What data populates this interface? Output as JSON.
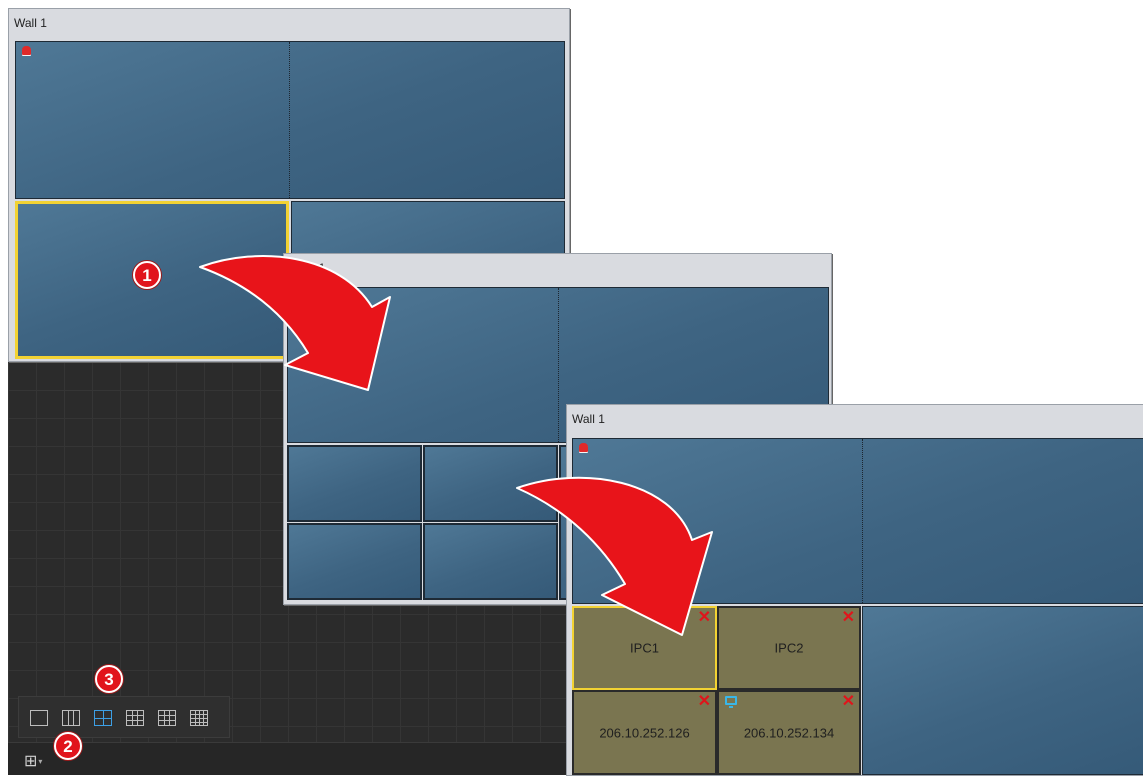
{
  "wall_title": "Wall 1",
  "wall_title_partial": "ll 1",
  "badges": {
    "one": "1",
    "two": "2",
    "three": "3"
  },
  "cells": [
    {
      "label": "IPC1"
    },
    {
      "label": "IPC2"
    },
    {
      "label": "206.10.252.126"
    },
    {
      "label": "206.10.252.134"
    }
  ],
  "close_glyph": "✕",
  "layout_glyph": "⊞",
  "caret_glyph": "▾",
  "layout_options": [
    "1x1",
    "1x3",
    "2x2",
    "3x3-alt",
    "3x3",
    "4x4"
  ],
  "active_layout": "2x2",
  "colors": {
    "tile": "#406886",
    "camera_tile": "#7a7550",
    "selection": "#f2d233",
    "close": "#e0141b",
    "arrow": "#e8141a",
    "badge": "#e1141c",
    "active_layout": "#3da0e6"
  }
}
